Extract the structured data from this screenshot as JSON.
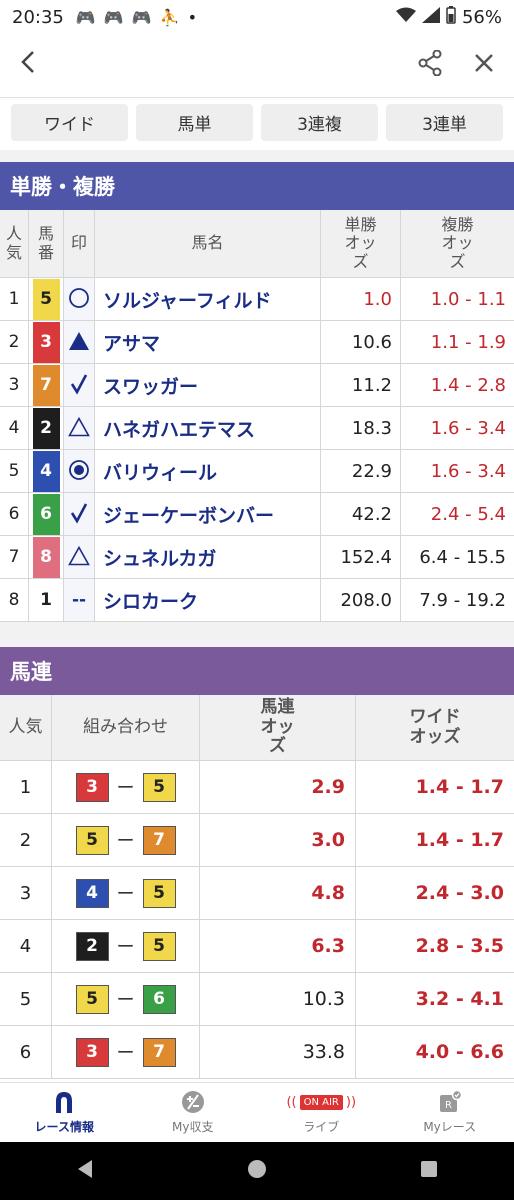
{
  "status_bar": {
    "time": "20:35",
    "battery": "56%"
  },
  "tabs": [
    "ワイド",
    "馬単",
    "3連複",
    "3連単"
  ],
  "win_place": {
    "title": "単勝・複勝",
    "headers": {
      "popularity": "人気",
      "number": "馬番",
      "mark": "印",
      "name": "馬名",
      "win": "単勝オッズ",
      "place": "複勝オッズ"
    },
    "rows": [
      {
        "pop": "1",
        "num": "5",
        "num_bg": "#f0d84a",
        "num_fg": "#222",
        "mark": "○",
        "mark_kind": "circle",
        "name": "ソルジャーフィルド",
        "win": "1.0",
        "win_red": true,
        "place": "1.0 - 1.1",
        "place_red": true
      },
      {
        "pop": "2",
        "num": "3",
        "num_bg": "#d8393a",
        "num_fg": "#fff",
        "mark": "▲",
        "mark_kind": "triangle-filled",
        "name": "アサマ",
        "win": "10.6",
        "win_red": false,
        "place": "1.1 - 1.9",
        "place_red": true
      },
      {
        "pop": "3",
        "num": "7",
        "num_bg": "#e08a2e",
        "num_fg": "#fff",
        "mark": "✓",
        "mark_kind": "check",
        "name": "スワッガー",
        "win": "11.2",
        "win_red": false,
        "place": "1.4 - 2.8",
        "place_red": true
      },
      {
        "pop": "4",
        "num": "2",
        "num_bg": "#1e1e1e",
        "num_fg": "#fff",
        "mark": "△",
        "mark_kind": "triangle-outline",
        "name": "ハネガハエテマス",
        "win": "18.3",
        "win_red": false,
        "place": "1.6 - 3.4",
        "place_red": true
      },
      {
        "pop": "5",
        "num": "4",
        "num_bg": "#2d4fb0",
        "num_fg": "#fff",
        "mark": "◉",
        "mark_kind": "double-circle",
        "name": "バリウィール",
        "win": "22.9",
        "win_red": false,
        "place": "1.6 - 3.4",
        "place_red": true
      },
      {
        "pop": "6",
        "num": "6",
        "num_bg": "#3aa047",
        "num_fg": "#fff",
        "mark": "✓",
        "mark_kind": "check",
        "name": "ジェーケーボンバー",
        "win": "42.2",
        "win_red": false,
        "place": "2.4 - 5.4",
        "place_red": true
      },
      {
        "pop": "7",
        "num": "8",
        "num_bg": "#df6e7f",
        "num_fg": "#fff",
        "mark": "△",
        "mark_kind": "triangle-outline",
        "name": "シュネルカガ",
        "win": "152.4",
        "win_red": false,
        "place": "6.4 - 15.5",
        "place_red": false
      },
      {
        "pop": "8",
        "num": "1",
        "num_bg": "#ffffff",
        "num_fg": "#222",
        "mark": "--",
        "mark_kind": "none",
        "name": "シロカーク",
        "win": "208.0",
        "win_red": false,
        "place": "7.9 - 19.2",
        "place_red": false
      }
    ]
  },
  "quinella": {
    "title": "馬連",
    "headers": {
      "popularity": "人気",
      "combo": "組み合わせ",
      "quinella": "馬連オッズ",
      "wide": "ワイドオッズ"
    },
    "rows": [
      {
        "pop": "1",
        "a": "3",
        "a_bg": "#d8393a",
        "a_fg": "#fff",
        "b": "5",
        "b_bg": "#f0d84a",
        "b_fg": "#222",
        "sep": "ー",
        "uren": "2.9",
        "uren_red": true,
        "wide": "1.4 - 1.7"
      },
      {
        "pop": "2",
        "a": "5",
        "a_bg": "#f0d84a",
        "a_fg": "#222",
        "b": "7",
        "b_bg": "#e08a2e",
        "b_fg": "#fff",
        "sep": "ー",
        "uren": "3.0",
        "uren_red": true,
        "wide": "1.4 - 1.7"
      },
      {
        "pop": "3",
        "a": "4",
        "a_bg": "#2d4fb0",
        "a_fg": "#fff",
        "b": "5",
        "b_bg": "#f0d84a",
        "b_fg": "#222",
        "sep": "ー",
        "uren": "4.8",
        "uren_red": true,
        "wide": "2.4 - 3.0"
      },
      {
        "pop": "4",
        "a": "2",
        "a_bg": "#1e1e1e",
        "a_fg": "#fff",
        "b": "5",
        "b_bg": "#f0d84a",
        "b_fg": "#222",
        "sep": "ー",
        "uren": "6.3",
        "uren_red": true,
        "wide": "2.8 - 3.5"
      },
      {
        "pop": "5",
        "a": "5",
        "a_bg": "#f0d84a",
        "a_fg": "#222",
        "b": "6",
        "b_bg": "#3aa047",
        "b_fg": "#fff",
        "sep": "ー",
        "uren": "10.3",
        "uren_red": false,
        "wide": "3.2 - 4.1"
      },
      {
        "pop": "6",
        "a": "3",
        "a_bg": "#d8393a",
        "a_fg": "#fff",
        "b": "7",
        "b_bg": "#e08a2e",
        "b_fg": "#fff",
        "sep": "ー",
        "uren": "33.8",
        "uren_red": false,
        "wide": "4.0 - 6.6"
      }
    ]
  },
  "bottom_nav": [
    {
      "label": "レース情報",
      "icon": "horseshoe-icon",
      "active": true
    },
    {
      "label": "My収支",
      "icon": "plus-minus-icon",
      "active": false
    },
    {
      "label": "ライブ",
      "icon": "on-air-icon",
      "active": false,
      "badge": "ON AIR"
    },
    {
      "label": "Myレース",
      "icon": "my-race-icon",
      "active": false
    }
  ],
  "colors": {
    "header_blue": "#4f55a7",
    "header_purple": "#7b5a9b",
    "odds_red": "#c0282d",
    "name_navy": "#1a2d86"
  }
}
